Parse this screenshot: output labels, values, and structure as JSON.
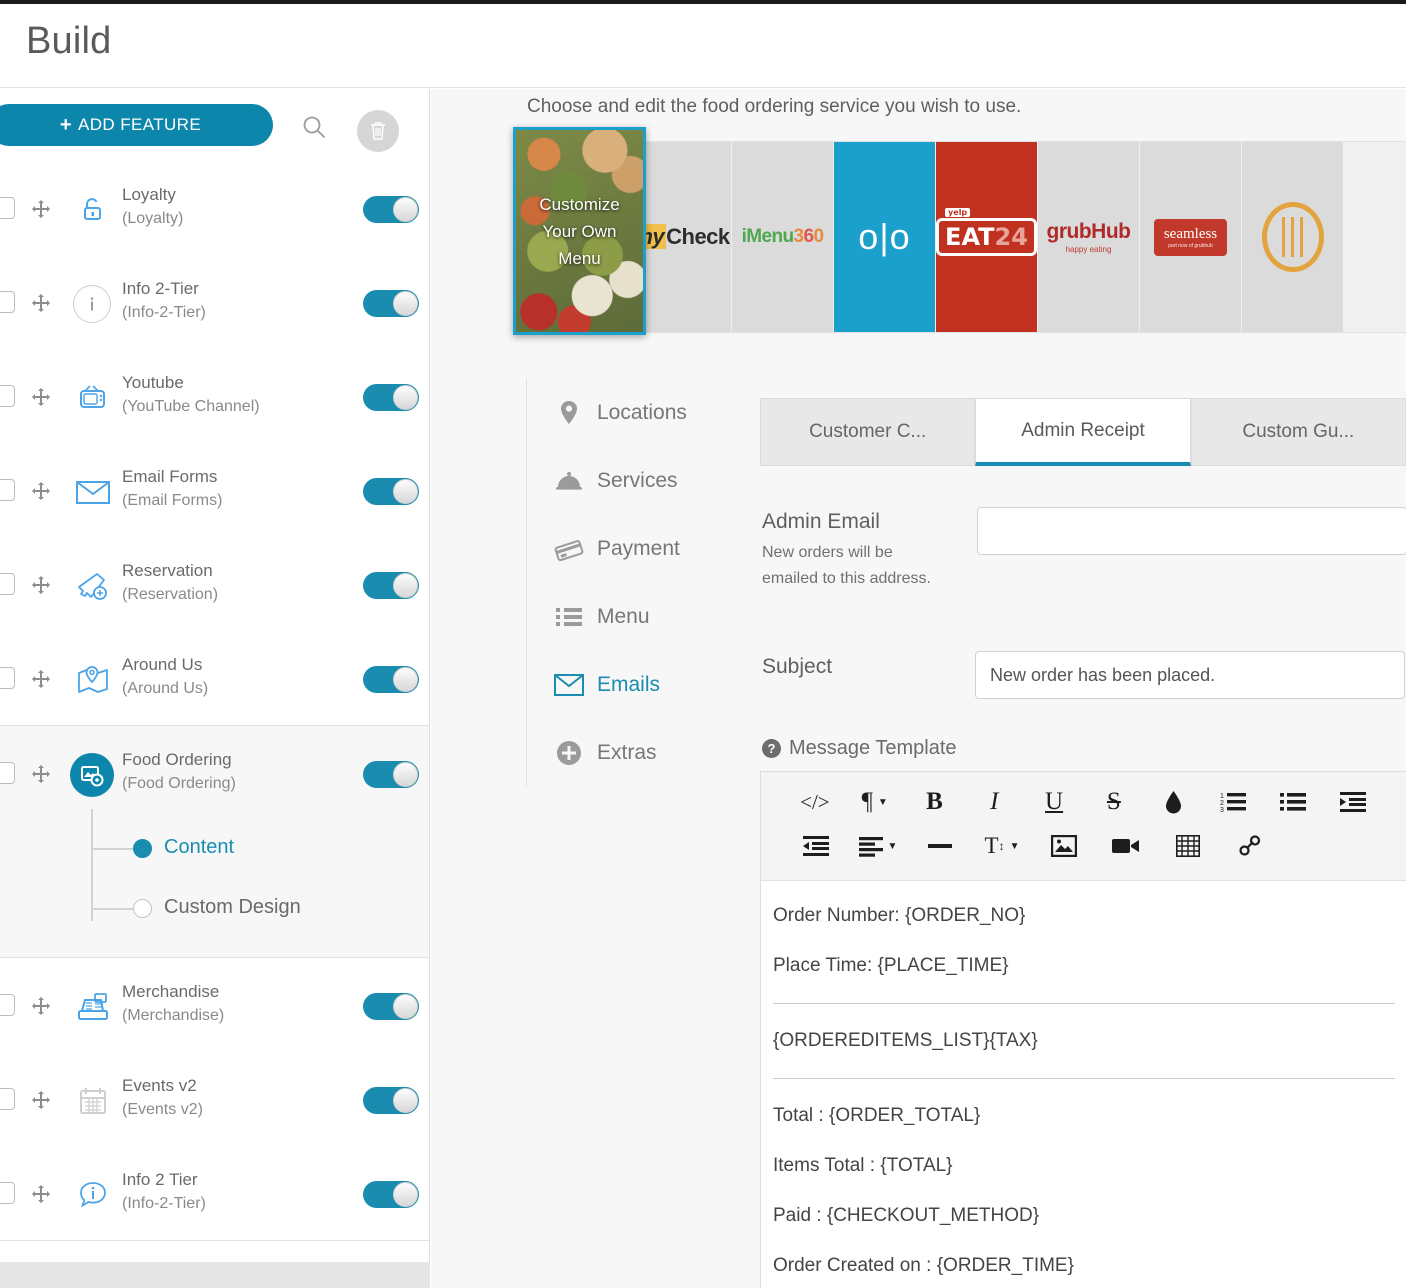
{
  "header": {
    "title": "Build"
  },
  "sidebar": {
    "add_feature_label": "ADD FEATURE",
    "plus": "+",
    "search_icon": "search-icon",
    "trash_icon": "trash-icon",
    "features": [
      {
        "name": "Loyalty",
        "sub": "(Loyalty)",
        "icon": "lock-icon",
        "enabled": true
      },
      {
        "name": "Info 2-Tier",
        "sub": "(Info-2-Tier)",
        "icon": "info-circle-icon",
        "enabled": true
      },
      {
        "name": "Youtube",
        "sub": "(YouTube Channel)",
        "icon": "tv-icon",
        "enabled": true
      },
      {
        "name": "Email Forms",
        "sub": "(Email Forms)",
        "icon": "envelope-icon",
        "enabled": true
      },
      {
        "name": "Reservation",
        "sub": "(Reservation)",
        "icon": "ticket-plus-icon",
        "enabled": true
      },
      {
        "name": "Around Us",
        "sub": "(Around Us)",
        "icon": "map-pin-icon",
        "enabled": true
      },
      {
        "name": "Food Ordering",
        "sub": "(Food Ordering)",
        "icon": "food-ordering-icon",
        "enabled": true
      },
      {
        "name": "Merchandise",
        "sub": "(Merchandise)",
        "icon": "cash-register-icon",
        "enabled": true
      },
      {
        "name": "Events v2",
        "sub": "(Events v2)",
        "icon": "calendar-icon",
        "enabled": true
      },
      {
        "name": "Info 2 Tier",
        "sub": "(Info-2-Tier)",
        "icon": "info-bubble-icon",
        "enabled": true
      }
    ],
    "sub_items": [
      {
        "label": "Content",
        "selected": true
      },
      {
        "label": "Custom Design",
        "selected": false
      }
    ]
  },
  "main": {
    "choose_text": "Choose and edit the food ordering service you wish to use.",
    "customize_tile": {
      "line1": "Customize",
      "line2": "Your Own",
      "line3": "Menu"
    },
    "services": [
      {
        "id": "mycheck",
        "label": "myCheck"
      },
      {
        "id": "imenu360",
        "label": "iMenu360"
      },
      {
        "id": "olo",
        "label": "olo"
      },
      {
        "id": "eat24",
        "label": "EAT24",
        "badge": "yelp",
        "num": "24"
      },
      {
        "id": "grubhub",
        "label": "grubHub",
        "tagline": "happy eating"
      },
      {
        "id": "seamless",
        "label": "seamless",
        "tagline": "food made easy ... grubhub"
      },
      {
        "id": "ring",
        "label": "ring-logo"
      }
    ],
    "nav": [
      {
        "label": "Locations",
        "icon": "map-pin-icon",
        "active": false
      },
      {
        "label": "Services",
        "icon": "cloche-icon",
        "active": false
      },
      {
        "label": "Payment",
        "icon": "card-icon",
        "active": false
      },
      {
        "label": "Menu",
        "icon": "list-icon",
        "active": false
      },
      {
        "label": "Emails",
        "icon": "envelope-icon",
        "active": true
      },
      {
        "label": "Extras",
        "icon": "plus-circle-icon",
        "active": false
      }
    ],
    "tabs": [
      {
        "label": "Customer C...",
        "active": false
      },
      {
        "label": "Admin Receipt",
        "active": true
      },
      {
        "label": "Custom Gu...",
        "active": false
      }
    ],
    "form": {
      "admin_email_label": "Admin Email",
      "admin_email_hint_1": "New orders will be",
      "admin_email_hint_2": "emailed to this address.",
      "admin_email_value": "",
      "admin_email_placeholder": "",
      "subject_label": "Subject",
      "subject_value": "New order has been placed."
    },
    "message_template": {
      "title": "Message Template",
      "help_icon": "?",
      "toolbar_row1": [
        {
          "name": "code-view-icon",
          "glyph": "</>",
          "caret": false
        },
        {
          "name": "paragraph-format-icon",
          "glyph": "¶",
          "caret": true
        },
        {
          "name": "bold-icon",
          "glyph": "B",
          "caret": false
        },
        {
          "name": "italic-icon",
          "glyph": "I",
          "caret": false
        },
        {
          "name": "underline-icon",
          "glyph": "U",
          "caret": false
        },
        {
          "name": "strikethrough-icon",
          "glyph": "S",
          "caret": false
        },
        {
          "name": "text-color-icon",
          "glyph": "◆",
          "caret": false
        },
        {
          "name": "ordered-list-icon",
          "glyph": "≔",
          "caret": false
        },
        {
          "name": "unordered-list-icon",
          "glyph": "☰",
          "caret": false
        },
        {
          "name": "indent-increase-icon",
          "glyph": "⇥",
          "caret": false
        }
      ],
      "toolbar_row2": [
        {
          "name": "indent-decrease-icon",
          "glyph": "⇤",
          "caret": false
        },
        {
          "name": "align-icon",
          "glyph": "≡",
          "caret": true
        },
        {
          "name": "horizontal-rule-icon",
          "glyph": "—",
          "caret": false
        },
        {
          "name": "font-size-icon",
          "glyph": "T",
          "caret": true
        },
        {
          "name": "insert-image-icon",
          "glyph": "🖼",
          "caret": false
        },
        {
          "name": "insert-video-icon",
          "glyph": "▶",
          "caret": false
        },
        {
          "name": "insert-table-icon",
          "glyph": "▦",
          "caret": false
        },
        {
          "name": "insert-link-icon",
          "glyph": "🔗",
          "caret": false
        }
      ],
      "body_lines": [
        {
          "type": "p",
          "text": "Order Number: {ORDER_NO}"
        },
        {
          "type": "p",
          "text": "Place Time: {PLACE_TIME}"
        },
        {
          "type": "hr",
          "text": ""
        },
        {
          "type": "p",
          "text": "{ORDEREDITEMS_LIST}{TAX}"
        },
        {
          "type": "hr",
          "text": ""
        },
        {
          "type": "p",
          "text": "Total : {ORDER_TOTAL}"
        },
        {
          "type": "p",
          "text": "Items Total : {TOTAL}"
        },
        {
          "type": "p",
          "text": "Paid : {CHECKOUT_METHOD}"
        },
        {
          "type": "p",
          "text": "Order Created on : {ORDER_TIME}"
        }
      ]
    }
  },
  "colors": {
    "accent": "#1a8cb0",
    "accent_dark": "#0d86ab",
    "olo_blue": "#1b9fcb",
    "eat24_red": "#c0311f",
    "grub_red": "#c0392b",
    "ring_orange": "#e3a33f"
  }
}
